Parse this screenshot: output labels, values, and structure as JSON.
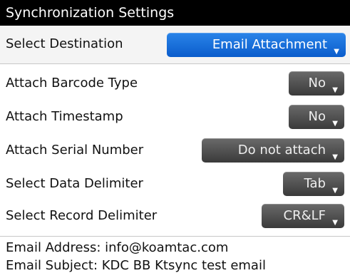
{
  "header": {
    "title": "Synchronization Settings"
  },
  "destination": {
    "label": "Select Destination",
    "value": "Email Attachment"
  },
  "settings": [
    {
      "label": "Attach Barcode Type",
      "value": "No"
    },
    {
      "label": "Attach Timestamp",
      "value": "No"
    },
    {
      "label": "Attach Serial Number",
      "value": "Do not attach"
    },
    {
      "label": "Select Data Delimiter",
      "value": "Tab"
    },
    {
      "label": "Select Record Delimiter",
      "value": "CR&LF"
    }
  ],
  "info": {
    "email_address": "Email Address: info@koamtac.com",
    "email_subject": "Email Subject: KDC BB Ktsync test email"
  },
  "caret": "▼",
  "colors": {
    "accent": "#0a6fde",
    "dropdown": "#4a4a4a",
    "title_bar": "#000000"
  }
}
